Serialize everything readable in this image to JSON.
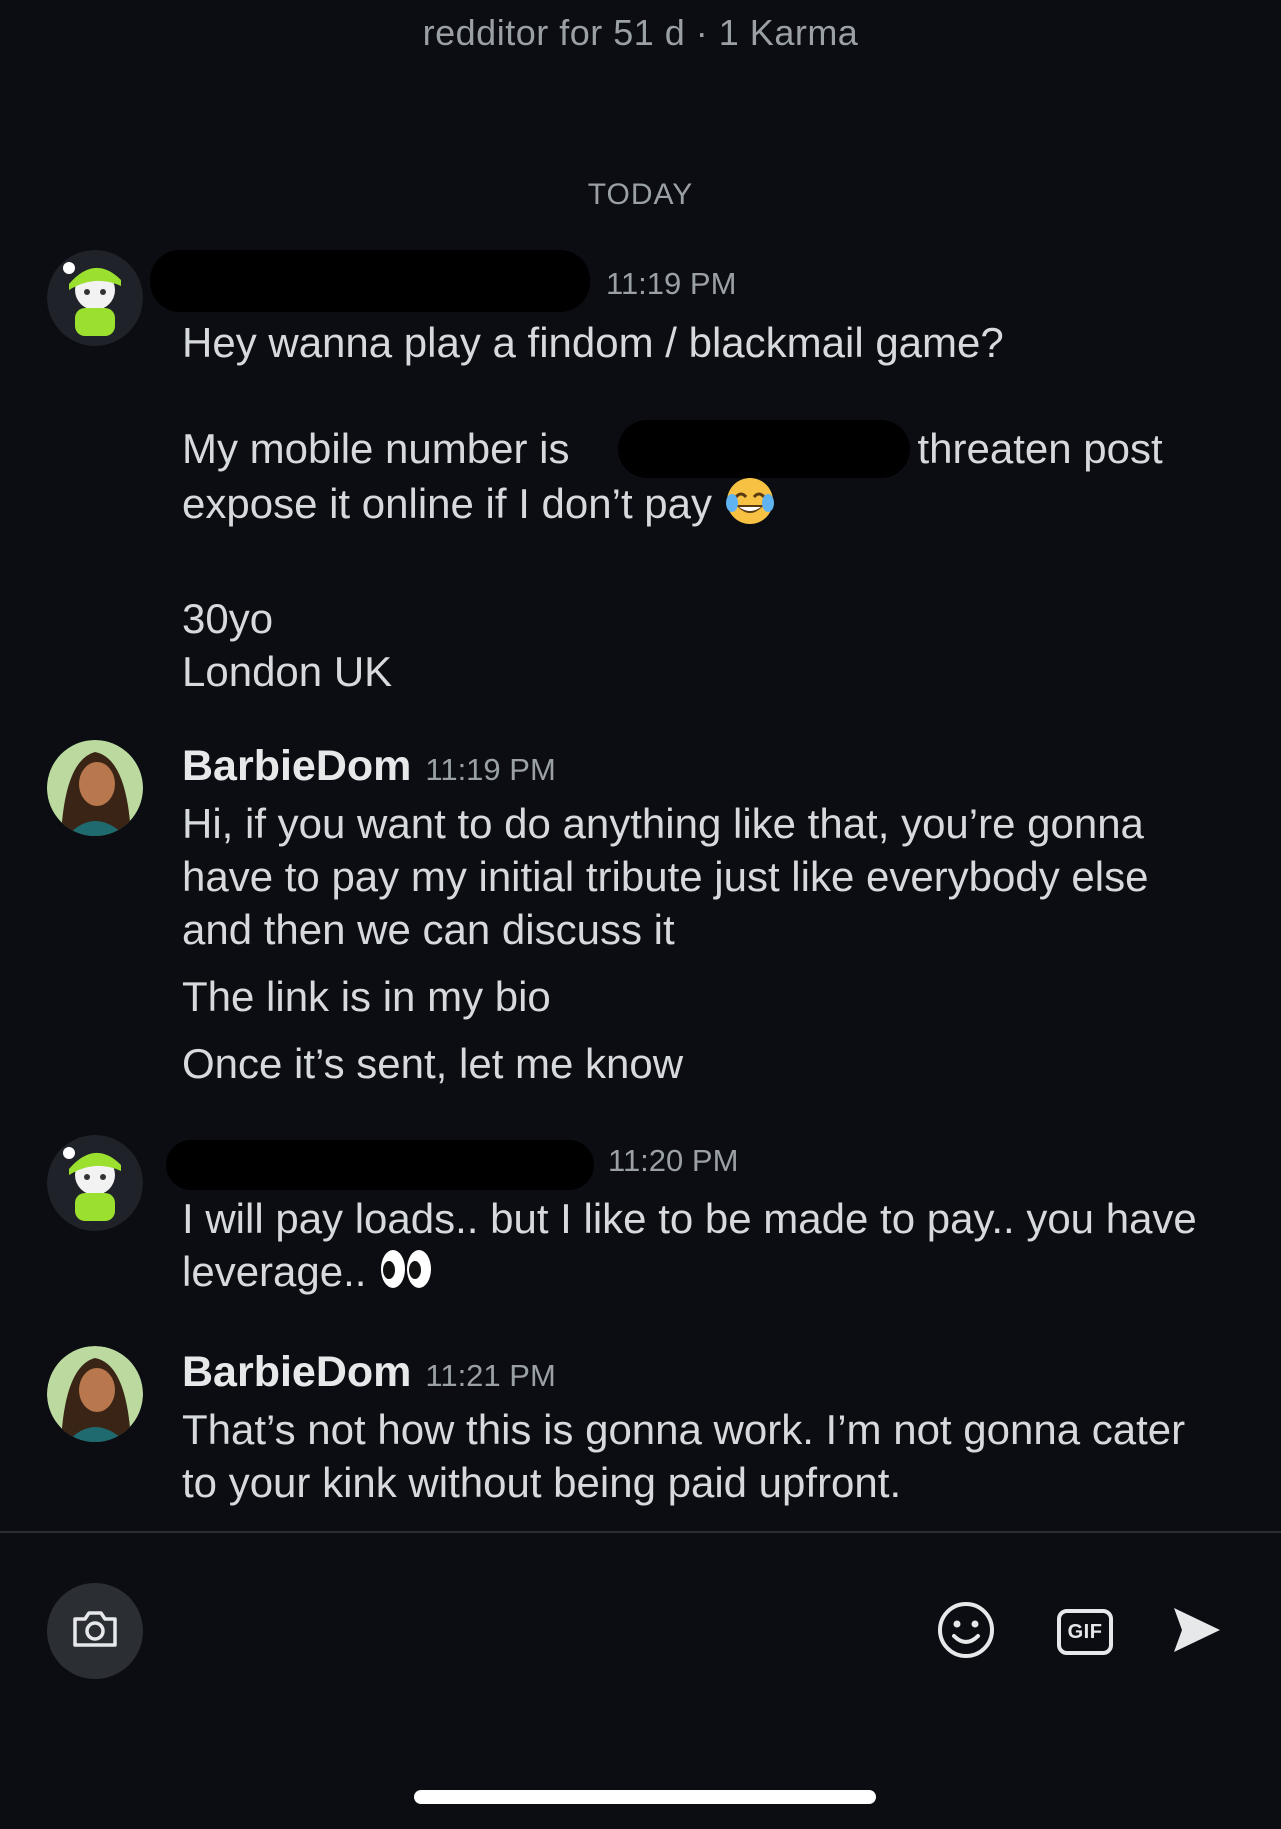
{
  "header": {
    "subtitle": "redditor for 51 d · 1 Karma"
  },
  "date_divider": "TODAY",
  "messages": [
    {
      "author": "",
      "author_redacted": true,
      "time": "11:19 PM",
      "avatar": "green-snoo-avatar",
      "lines": [
        "Hey wanna play a findom / blackmail game?",
        "My mobile number is",
        "... threaten post expose it online if I don’t pay",
        "30yo",
        "London UK"
      ],
      "emoji": "tears-of-joy-emoji"
    },
    {
      "author": "BarbieDom",
      "time": "11:19 PM",
      "avatar": "barbiedom-avatar",
      "lines": [
        "Hi, if you want to do anything like that, you’re gonna have to pay my initial tribute just like everybody else and then we can discuss it",
        "The link is in my bio",
        "Once it’s sent, let me know"
      ]
    },
    {
      "author": "",
      "author_redacted": true,
      "time": "11:20 PM",
      "avatar": "green-snoo-avatar",
      "lines": [
        "I will pay loads.. but I like to be made to pay.. you have leverage.."
      ],
      "emoji": "eyes-emoji"
    },
    {
      "author": "BarbieDom",
      "time": "11:21 PM",
      "avatar": "barbiedom-avatar",
      "lines": [
        "That’s not how this is gonna work. I’m not gonna cater to your kink without being paid upfront."
      ]
    }
  ],
  "composer": {
    "camera_icon": "camera-icon",
    "emoji_icon": "smiley-icon",
    "gif_label": "GIF",
    "send_icon": "send-icon"
  },
  "colors": {
    "background": "#0b0d12",
    "text": "#d7dadc",
    "muted": "#9aa0a6",
    "snoo_green": "#9be02f"
  }
}
